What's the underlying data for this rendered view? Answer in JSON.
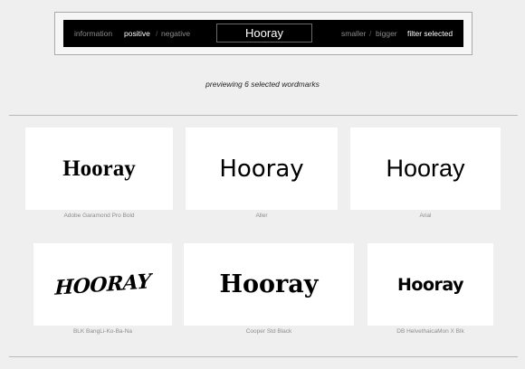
{
  "toolbar": {
    "information": "information",
    "positive": "positive",
    "slash": "/",
    "negative": "negative",
    "preview_text": "Hooray",
    "smaller": "smaller",
    "bigger": "bigger",
    "filter_selected": "filter selected"
  },
  "caption": "previewing 6 selected wordmarks",
  "wordmarks": [
    {
      "sample": "Hooray",
      "font": "Adobe Garamond Pro Bold"
    },
    {
      "sample": "Hooray",
      "font": "Aller"
    },
    {
      "sample": "Hooray",
      "font": "Arial"
    },
    {
      "sample": "HOORAY",
      "font": "BLK BangLi-Ko-Ba-Na"
    },
    {
      "sample": "Hooray",
      "font": "Cooper Std Black"
    },
    {
      "sample": "Hooray",
      "font": "DB HelvethaicaMon X Blk"
    }
  ]
}
